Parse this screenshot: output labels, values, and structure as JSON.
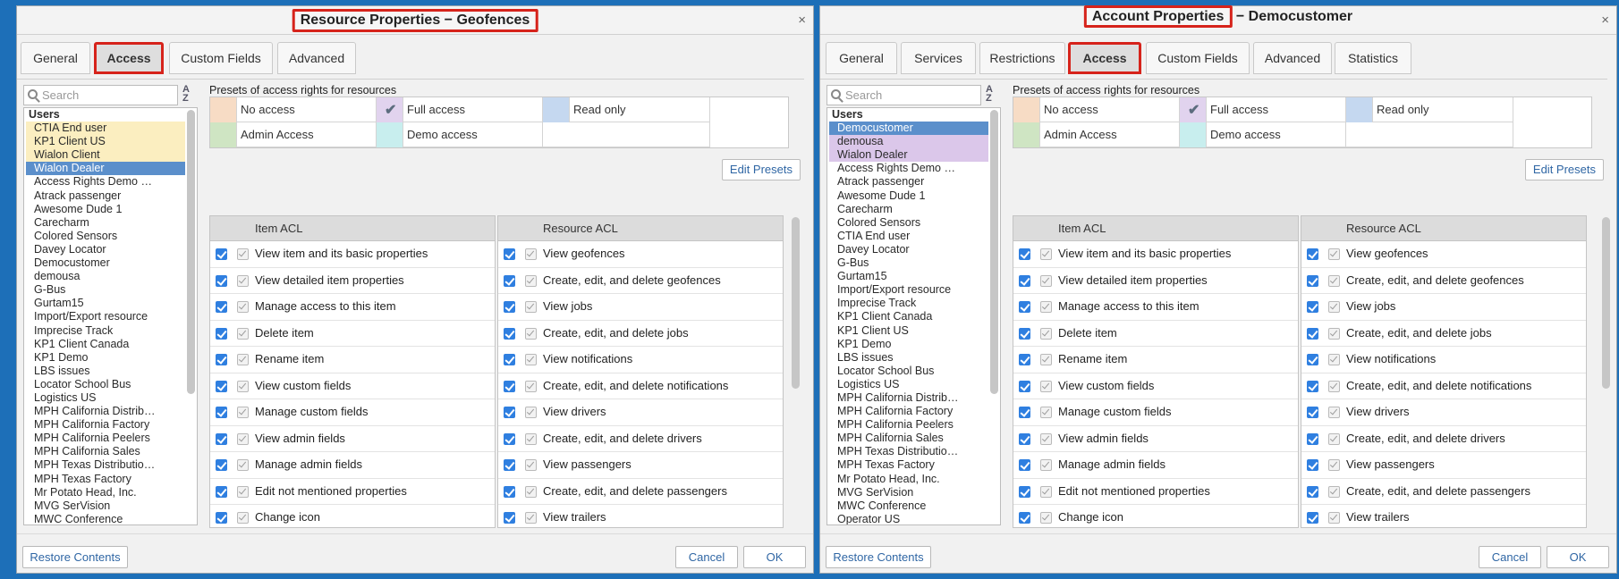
{
  "dialogs": [
    {
      "title": "Resource Properties − Geofences",
      "tabs": [
        "General",
        "Access",
        "Custom Fields",
        "Advanced"
      ],
      "active_tab": "Access",
      "search_placeholder": "Search",
      "users_header": "Users",
      "users": [
        {
          "name": "CTIA End user",
          "hl": "yellow"
        },
        {
          "name": "KP1 Client US",
          "hl": "yellow"
        },
        {
          "name": "Wialon Client",
          "hl": "yellow"
        },
        {
          "name": "Wialon Dealer",
          "hl": "blue"
        },
        {
          "name": "Access Rights Demo …",
          "hl": ""
        },
        {
          "name": "Atrack passenger",
          "hl": ""
        },
        {
          "name": "Awesome Dude 1",
          "hl": ""
        },
        {
          "name": "Carecharm",
          "hl": ""
        },
        {
          "name": "Colored Sensors",
          "hl": ""
        },
        {
          "name": "Davey Locator",
          "hl": ""
        },
        {
          "name": "Democustomer",
          "hl": ""
        },
        {
          "name": "demousa",
          "hl": ""
        },
        {
          "name": "G-Bus",
          "hl": ""
        },
        {
          "name": "Gurtam15",
          "hl": ""
        },
        {
          "name": "Import/Export resource",
          "hl": ""
        },
        {
          "name": "Imprecise Track",
          "hl": ""
        },
        {
          "name": "KP1 Client Canada",
          "hl": ""
        },
        {
          "name": "KP1 Demo",
          "hl": ""
        },
        {
          "name": "LBS issues",
          "hl": ""
        },
        {
          "name": "Locator School Bus",
          "hl": ""
        },
        {
          "name": "Logistics US",
          "hl": ""
        },
        {
          "name": "MPH California Distrib…",
          "hl": ""
        },
        {
          "name": "MPH California Factory",
          "hl": ""
        },
        {
          "name": "MPH California Peelers",
          "hl": ""
        },
        {
          "name": "MPH California Sales",
          "hl": ""
        },
        {
          "name": "MPH Texas Distributio…",
          "hl": ""
        },
        {
          "name": "MPH Texas Factory",
          "hl": ""
        },
        {
          "name": "Mr Potato Head, Inc.",
          "hl": ""
        },
        {
          "name": "MVG SerVision",
          "hl": ""
        },
        {
          "name": "MWC Conference",
          "hl": ""
        }
      ],
      "edit_presets": "Edit Presets",
      "restore_contents": "Restore Contents",
      "cancel": "Cancel",
      "ok": "OK"
    },
    {
      "title_part1": "Account Properties",
      "title_part2": " − Democustomer",
      "tabs": [
        "General",
        "Services",
        "Restrictions",
        "Access",
        "Custom Fields",
        "Advanced",
        "Statistics"
      ],
      "active_tab": "Access",
      "search_placeholder": "Search",
      "users_header": "Users",
      "users": [
        {
          "name": "Democustomer",
          "hl": "blue"
        },
        {
          "name": "demousa",
          "hl": "purple"
        },
        {
          "name": "Wialon Dealer",
          "hl": "purple"
        },
        {
          "name": "Access Rights Demo …",
          "hl": ""
        },
        {
          "name": "Atrack passenger",
          "hl": ""
        },
        {
          "name": "Awesome Dude 1",
          "hl": ""
        },
        {
          "name": "Carecharm",
          "hl": ""
        },
        {
          "name": "Colored Sensors",
          "hl": ""
        },
        {
          "name": "CTIA End user",
          "hl": ""
        },
        {
          "name": "Davey Locator",
          "hl": ""
        },
        {
          "name": "G-Bus",
          "hl": ""
        },
        {
          "name": "Gurtam15",
          "hl": ""
        },
        {
          "name": "Import/Export resource",
          "hl": ""
        },
        {
          "name": "Imprecise Track",
          "hl": ""
        },
        {
          "name": "KP1 Client Canada",
          "hl": ""
        },
        {
          "name": "KP1 Client US",
          "hl": ""
        },
        {
          "name": "KP1 Demo",
          "hl": ""
        },
        {
          "name": "LBS issues",
          "hl": ""
        },
        {
          "name": "Locator School Bus",
          "hl": ""
        },
        {
          "name": "Logistics US",
          "hl": ""
        },
        {
          "name": "MPH California Distrib…",
          "hl": ""
        },
        {
          "name": "MPH California Factory",
          "hl": ""
        },
        {
          "name": "MPH California Peelers",
          "hl": ""
        },
        {
          "name": "MPH California Sales",
          "hl": ""
        },
        {
          "name": "MPH Texas Distributio…",
          "hl": ""
        },
        {
          "name": "MPH Texas Factory",
          "hl": ""
        },
        {
          "name": "Mr Potato Head, Inc.",
          "hl": ""
        },
        {
          "name": "MVG SerVision",
          "hl": ""
        },
        {
          "name": "MWC Conference",
          "hl": ""
        },
        {
          "name": "Operator US",
          "hl": ""
        }
      ],
      "edit_presets": "Edit Presets",
      "restore_contents": "Restore Contents",
      "cancel": "Cancel",
      "ok": "OK"
    }
  ],
  "presets_label": "Presets of access rights for resources",
  "presets": [
    {
      "label": "No access",
      "color": "#f7dcc5",
      "checked": false
    },
    {
      "label": "Full access",
      "color": "#e1d3ee",
      "checked": true
    },
    {
      "label": "Read only",
      "color": "#c5d8f0",
      "checked": false
    },
    {
      "label": "Admin Access",
      "color": "#cfe5c3",
      "checked": false
    },
    {
      "label": "Demo access",
      "color": "#c8eeee",
      "checked": false
    }
  ],
  "item_acl_header": "Item ACL",
  "resource_acl_header": "Resource ACL",
  "item_acl": [
    "View item and its basic properties",
    "View detailed item properties",
    "Manage access to this item",
    "Delete item",
    "Rename item",
    "View custom fields",
    "Manage custom fields",
    "View admin fields",
    "Manage admin fields",
    "Edit not mentioned properties",
    "Change icon"
  ],
  "resource_acl": [
    "View geofences",
    "Create, edit, and delete geofences",
    "View jobs",
    "Create, edit, and delete jobs",
    "View notifications",
    "Create, edit, and delete notifications",
    "View drivers",
    "Create, edit, and delete drivers",
    "View passengers",
    "Create, edit, and delete passengers",
    "View trailers"
  ],
  "close_glyph": "×",
  "az_top": "A",
  "az_bottom": "Z"
}
